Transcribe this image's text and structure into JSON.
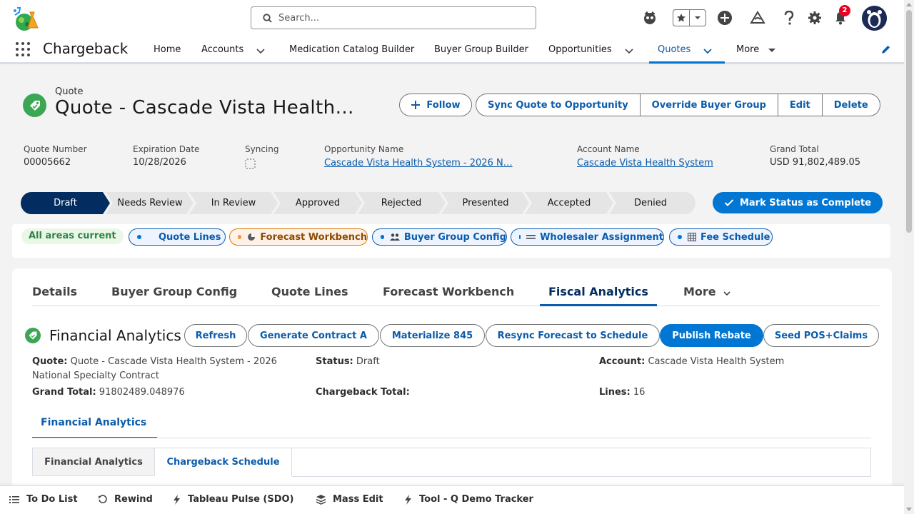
{
  "header": {
    "search_placeholder": "Search...",
    "notification_count": "2"
  },
  "nav": {
    "app_name": "Chargeback",
    "items": [
      {
        "label": "Home"
      },
      {
        "label": "Accounts"
      },
      {
        "label": "Medication Catalog Builder"
      },
      {
        "label": "Buyer Group Builder"
      },
      {
        "label": "Opportunities"
      },
      {
        "label": "Quotes"
      },
      {
        "label": "More"
      }
    ],
    "active": "Quotes"
  },
  "record": {
    "object_label": "Quote",
    "title": "Quote - Cascade Vista Health…",
    "follow_label": "Follow",
    "actions": [
      "Sync Quote to Opportunity",
      "Override Buyer Group",
      "Edit",
      "Delete"
    ]
  },
  "highlights": [
    {
      "label": "Quote Number",
      "value": "00005662"
    },
    {
      "label": "Expiration Date",
      "value": "10/28/2026"
    },
    {
      "label": "Syncing",
      "value": ""
    },
    {
      "label": "Opportunity Name",
      "value": "Cascade Vista Health System - 2026 N…"
    },
    {
      "label": "Account Name",
      "value": "Cascade Vista Health System"
    },
    {
      "label": "Grand Total",
      "value": "USD 91,802,489.05"
    }
  ],
  "path": {
    "stages": [
      "Draft",
      "Needs Review",
      "In Review",
      "Approved",
      "Rejected",
      "Presented",
      "Accepted",
      "Denied"
    ],
    "current": "Draft",
    "mark_complete_label": "Mark Status as Complete"
  },
  "areas": {
    "status_label": "All areas current",
    "pills": [
      {
        "label": "Quote Lines",
        "icon": "none"
      },
      {
        "label": "Forecast Workbench",
        "icon": "pie-icon"
      },
      {
        "label": "Buyer Group Config",
        "icon": "people-icon"
      },
      {
        "label": "Wholesaler Assignment",
        "icon": "lines-icon"
      },
      {
        "label": "Fee Schedule",
        "icon": "table-icon"
      }
    ]
  },
  "tabs": {
    "items": [
      "Details",
      "Buyer Group Config",
      "Quote Lines",
      "Forecast Workbench",
      "Fiscal Analytics",
      "More"
    ],
    "active": "Fiscal Analytics"
  },
  "financial": {
    "title": "Financial Analytics",
    "buttons": [
      "Refresh",
      "Generate Contract A",
      "Materialize 845",
      "Resync Forecast to Schedule",
      "Publish Rebate",
      "Seed POS+Claims"
    ],
    "fields": {
      "quote_label": "Quote:",
      "quote_value_line1": "Quote - Cascade Vista Health System - 2026",
      "quote_value_line2": "National Specialty Contract",
      "status_label": "Status:",
      "status_value": "Draft",
      "account_label": "Account:",
      "account_value": "Cascade Vista Health System",
      "grand_total_label": "Grand Total:",
      "grand_total_value": "91802489.048976",
      "chargeback_total_label": "Chargeback Total:",
      "chargeback_total_value": "",
      "lines_label": "Lines:",
      "lines_value": "16"
    },
    "sub_tab": "Financial Analytics",
    "inner_tabs": [
      "Financial Analytics",
      "Chargeback Schedule"
    ],
    "inner_active": "Chargeback Schedule"
  },
  "footer": {
    "items": [
      {
        "label": "To Do List",
        "icon": "list-icon"
      },
      {
        "label": "Rewind",
        "icon": "rewind-icon"
      },
      {
        "label": "Tableau Pulse (SDO)",
        "icon": "bolt-icon"
      },
      {
        "label": "Mass Edit",
        "icon": "layers-icon"
      },
      {
        "label": "Tool - Q Demo Tracker",
        "icon": "bolt-icon"
      }
    ]
  },
  "colors": {
    "brand": "#0176d3",
    "path_active": "#032d60",
    "success": "#3ba755",
    "warning": "#dd7a01"
  }
}
